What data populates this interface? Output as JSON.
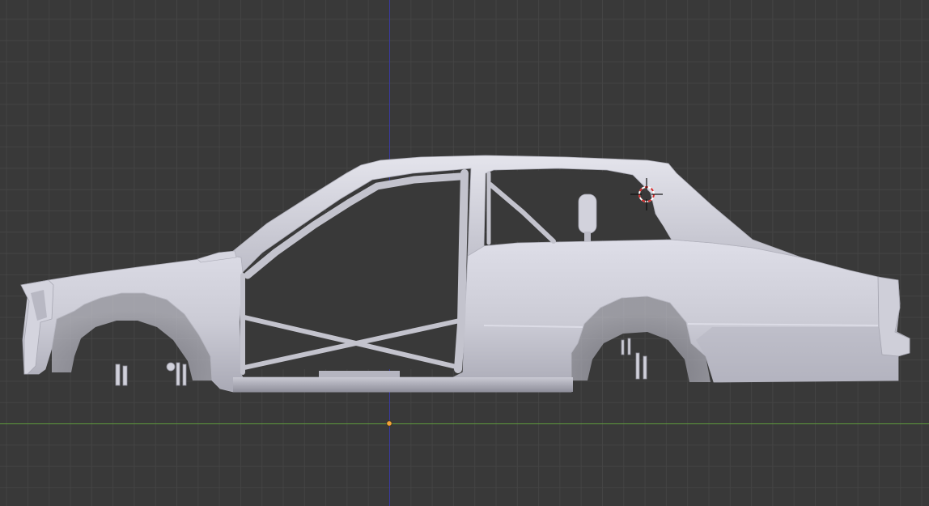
{
  "editor": "3d-viewport",
  "view": "side-orthographic",
  "shading": "solid",
  "colors": {
    "background": "#393939",
    "grid_minor": "#444444",
    "grid_major": "#4b4b4b",
    "axis_x": "#5e9a3c",
    "axis_z": "#3a3aa0",
    "model_light": "#dcdce6",
    "model_mid": "#c6c6d0",
    "model_dark": "#9e9eaa",
    "origin_dot": "#f1a33a",
    "cursor_ring_red": "#d62a2a",
    "cursor_ring_white": "#ffffff",
    "cursor_crosshair": "#111111"
  },
  "icons": {
    "origin": "object-origin-icon",
    "cursor": "3d-cursor-icon"
  },
  "model": {
    "name": "car-body-shell-with-roll-cage"
  }
}
